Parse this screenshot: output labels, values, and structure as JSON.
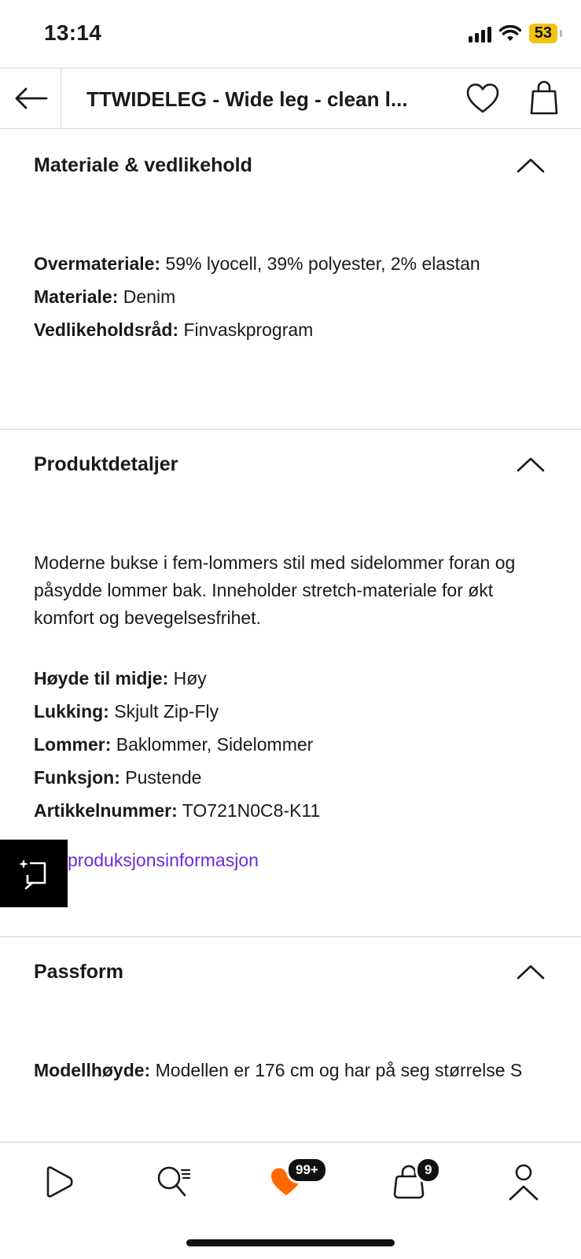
{
  "status_bar": {
    "time": "13:14",
    "battery": "53"
  },
  "header": {
    "title": "TTWIDELEG - Wide leg - clean l..."
  },
  "sections": [
    {
      "title": "Materiale & vedlikehold",
      "rows": [
        {
          "label": "Overmateriale:",
          "value": " 59% lyocell, 39% polyester, 2% elastan"
        },
        {
          "label": "Materiale:",
          "value": " Denim"
        },
        {
          "label": "Vedlikeholdsråd:",
          "value": " Finvaskprogram"
        }
      ]
    },
    {
      "title": "Produktdetaljer",
      "description": "Moderne bukse i fem-lommers stil med sidelommer foran og påsydde lommer bak. Inneholder stretch-materiale for økt komfort og bevegelsesfrihet.",
      "rows": [
        {
          "label": "Høyde til midje:",
          "value": " Høy"
        },
        {
          "label": "Lukking:",
          "value": " Skjult Zip-Fly"
        },
        {
          "label": "Lommer:",
          "value": " Baklommer, Sidelommer"
        },
        {
          "label": "Funksjon:",
          "value": " Pustende"
        },
        {
          "label": "Artikkelnummer:",
          "value": " TO721N0C8-K11"
        }
      ],
      "link": "produksjonsinformasjon"
    },
    {
      "title": "Passform",
      "rows": [
        {
          "label": "Modellhøyde:",
          "value": " Modellen er 176 cm og har på seg størrelse S"
        }
      ]
    }
  ],
  "tab_bar": {
    "wishlist_badge": "99+",
    "cart_badge": "9"
  },
  "colors": {
    "link": "#6b2dd6",
    "battery": "#f2c50f",
    "accent": "#ff6900"
  }
}
